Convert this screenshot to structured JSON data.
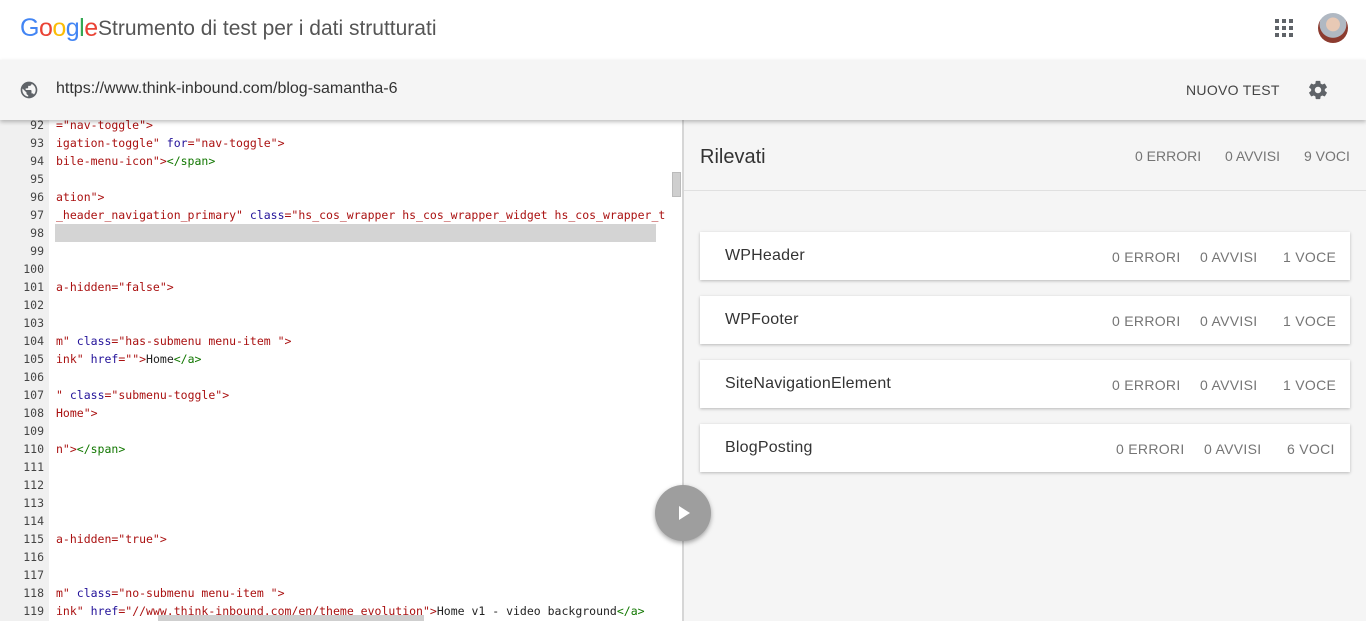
{
  "header": {
    "logo": "Google",
    "logo_colors": [
      "#4285F4",
      "#EA4335",
      "#FBBC05",
      "#4285F4",
      "#34A853",
      "#EA4335"
    ],
    "title": "Strumento di test per i dati strutturati",
    "apps_icon": "apps-grid-icon",
    "avatar_icon": "user-avatar"
  },
  "urlbar": {
    "globe_icon": "globe-icon",
    "url": "https://www.think-inbound.com/blog-samantha-6",
    "new_test_label": "NUOVO TEST",
    "settings_icon": "gear-icon"
  },
  "editor": {
    "lines": [
      {
        "n": "92",
        "tokens": [
          {
            "t": "str",
            "v": "=\"nav-toggle\">"
          }
        ]
      },
      {
        "n": "93",
        "tokens": [
          {
            "t": "str",
            "v": "igation-toggle\""
          },
          {
            "t": "txt",
            "v": " "
          },
          {
            "t": "attr",
            "v": "for"
          },
          {
            "t": "str",
            "v": "=\"nav-toggle\">"
          }
        ]
      },
      {
        "n": "94",
        "tokens": [
          {
            "t": "str",
            "v": "bile-menu-icon\">"
          },
          {
            "t": "tag",
            "v": "</span>"
          }
        ]
      },
      {
        "n": "95",
        "tokens": []
      },
      {
        "n": "96",
        "tokens": [
          {
            "t": "str",
            "v": "ation\">"
          }
        ]
      },
      {
        "n": "97",
        "tokens": [
          {
            "t": "str",
            "v": "_header_navigation_primary\""
          },
          {
            "t": "txt",
            "v": " "
          },
          {
            "t": "attr",
            "v": "class"
          },
          {
            "t": "str",
            "v": "=\"hs_cos_wrapper hs_cos_wrapper_widget hs_cos_wrapper_t"
          }
        ]
      },
      {
        "n": "98",
        "tokens": []
      },
      {
        "n": "99",
        "tokens": []
      },
      {
        "n": "100",
        "tokens": []
      },
      {
        "n": "101",
        "tokens": [
          {
            "t": "str",
            "v": "a-hidden=\"false\">"
          }
        ]
      },
      {
        "n": "102",
        "tokens": []
      },
      {
        "n": "103",
        "tokens": []
      },
      {
        "n": "104",
        "tokens": [
          {
            "t": "str",
            "v": "m\""
          },
          {
            "t": "txt",
            "v": " "
          },
          {
            "t": "attr",
            "v": "class"
          },
          {
            "t": "str",
            "v": "=\"has-submenu menu-item \">"
          }
        ]
      },
      {
        "n": "105",
        "tokens": [
          {
            "t": "str",
            "v": "ink\""
          },
          {
            "t": "txt",
            "v": " "
          },
          {
            "t": "attr",
            "v": "href"
          },
          {
            "t": "str",
            "v": "=\"\">"
          },
          {
            "t": "txt",
            "v": "Home"
          },
          {
            "t": "tag",
            "v": "</a>"
          }
        ]
      },
      {
        "n": "106",
        "tokens": []
      },
      {
        "n": "107",
        "tokens": [
          {
            "t": "str",
            "v": "\""
          },
          {
            "t": "txt",
            "v": " "
          },
          {
            "t": "attr",
            "v": "class"
          },
          {
            "t": "str",
            "v": "=\"submenu-toggle\">"
          }
        ]
      },
      {
        "n": "108",
        "tokens": [
          {
            "t": "str",
            "v": "Home\">"
          }
        ]
      },
      {
        "n": "109",
        "tokens": []
      },
      {
        "n": "110",
        "tokens": [
          {
            "t": "str",
            "v": "n\">"
          },
          {
            "t": "tag",
            "v": "</span>"
          }
        ]
      },
      {
        "n": "111",
        "tokens": []
      },
      {
        "n": "112",
        "tokens": []
      },
      {
        "n": "113",
        "tokens": []
      },
      {
        "n": "114",
        "tokens": []
      },
      {
        "n": "115",
        "tokens": [
          {
            "t": "str",
            "v": "a-hidden=\"true\">"
          }
        ]
      },
      {
        "n": "116",
        "tokens": []
      },
      {
        "n": "117",
        "tokens": []
      },
      {
        "n": "118",
        "tokens": [
          {
            "t": "str",
            "v": "m\""
          },
          {
            "t": "txt",
            "v": " "
          },
          {
            "t": "attr",
            "v": "class"
          },
          {
            "t": "str",
            "v": "=\"no-submenu menu-item \">"
          }
        ]
      },
      {
        "n": "119",
        "tokens": [
          {
            "t": "str",
            "v": "ink\""
          },
          {
            "t": "txt",
            "v": " "
          },
          {
            "t": "attr",
            "v": "href"
          },
          {
            "t": "str",
            "v": "=\"//www.think-inbound.com/en/theme_evolution\">"
          },
          {
            "t": "txt",
            "v": "Home v1 - video background"
          },
          {
            "t": "tag",
            "v": "</a>"
          }
        ]
      }
    ],
    "run_icon": "play-icon"
  },
  "results": {
    "title": "Rilevati",
    "errors": "0 ERRORI",
    "warnings": "0 AVVISI",
    "items": "9 VOCI",
    "cards": [
      {
        "name": "WPHeader",
        "errors": "0 ERRORI",
        "warnings": "0 AVVISI",
        "items": "1 VOCE"
      },
      {
        "name": "WPFooter",
        "errors": "0 ERRORI",
        "warnings": "0 AVVISI",
        "items": "1 VOCE"
      },
      {
        "name": "SiteNavigationElement",
        "errors": "0 ERRORI",
        "warnings": "0 AVVISI",
        "items": "1 VOCE"
      },
      {
        "name": "BlogPosting",
        "errors": "0 ERRORI",
        "warnings": "0 AVVISI",
        "items": "6 VOCI"
      }
    ]
  }
}
